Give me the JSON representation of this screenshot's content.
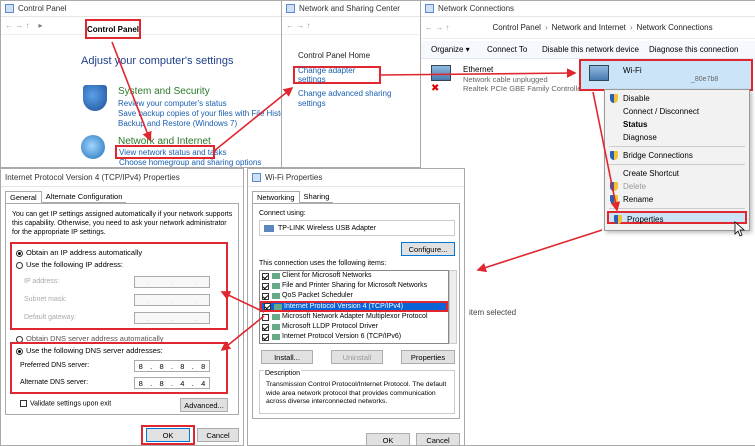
{
  "control_panel": {
    "title": "Control Panel",
    "breadcrumb": "Control Panel",
    "heading": "Adjust your computer's settings",
    "sections": [
      {
        "title": "System and Security",
        "links": [
          "Review your computer's status",
          "Save backup copies of your files with File History",
          "Backup and Restore (Windows 7)"
        ]
      },
      {
        "title": "Network and Internet",
        "links": [
          "View network status and tasks",
          "Choose homegroup and sharing options"
        ]
      }
    ]
  },
  "sharing_center": {
    "title": "Network and Sharing Center",
    "links": [
      "Control Panel Home",
      "Change adapter settings",
      "Change advanced sharing settings"
    ]
  },
  "net_connections": {
    "title": "Network Connections",
    "breadcrumb": [
      "Control Panel",
      "Network and Internet",
      "Network Connections"
    ],
    "toolbar": [
      "Organize ▾",
      "Connect To",
      "Disable this network device",
      "Diagnose this connection"
    ],
    "adapters": [
      {
        "name": "Ethernet",
        "status": "Network cable unplugged",
        "device": "Realtek PCIe GBE Family Controller"
      },
      {
        "name": "Wi-Fi",
        "status": "_80e7b8",
        "device": "TP-LINK Wireless USB Adapter"
      }
    ],
    "status_text": "item selected",
    "context_menu": [
      "Disable",
      "Connect / Disconnect",
      "Status",
      "Diagnose",
      "Bridge Connections",
      "Create Shortcut",
      "Delete",
      "Rename",
      "Properties"
    ]
  },
  "ipv4": {
    "title": "Internet Protocol Version 4 (TCP/IPv4) Properties",
    "tabs": [
      "General",
      "Alternate Configuration"
    ],
    "description": "You can get IP settings assigned automatically if your network supports this capability. Otherwise, you need to ask your network administrator for the appropriate IP settings.",
    "ip_auto": "Obtain an IP address automatically",
    "ip_manual": "Use the following IP address:",
    "ip_fields": [
      "IP address:",
      "Subnet mask:",
      "Default gateway:"
    ],
    "dns_auto": "Obtain DNS server address automatically",
    "dns_manual": "Use the following DNS server addresses:",
    "dns_pref_label": "Preferred DNS server:",
    "dns_pref": [
      "8",
      "8",
      "8",
      "8"
    ],
    "dns_alt_label": "Alternate DNS server:",
    "dns_alt": [
      "8",
      "8",
      "4",
      "4"
    ],
    "validate": "Validate settings upon exit",
    "advanced": "Advanced...",
    "ok": "OK",
    "cancel": "Cancel"
  },
  "wifi_props": {
    "title": "Wi-Fi Properties",
    "tabs": [
      "Networking",
      "Sharing"
    ],
    "connect_using": "Connect using:",
    "adapter": "TP-LINK Wireless USB Adapter",
    "configure": "Configure...",
    "items_label": "This connection uses the following items:",
    "items": [
      {
        "label": "Client for Microsoft Networks",
        "checked": true
      },
      {
        "label": "File and Printer Sharing for Microsoft Networks",
        "checked": true
      },
      {
        "label": "QoS Packet Scheduler",
        "checked": true
      },
      {
        "label": "Internet Protocol Version 4 (TCP/IPv4)",
        "checked": true
      },
      {
        "label": "Microsoft Network Adapter Multiplexor Protocol",
        "checked": false
      },
      {
        "label": "Microsoft LLDP Protocol Driver",
        "checked": true
      },
      {
        "label": "Internet Protocol Version 6 (TCP/IPv6)",
        "checked": true
      }
    ],
    "install": "Install...",
    "uninstall": "Uninstall",
    "properties": "Properties",
    "desc_label": "Description",
    "description": "Transmission Control Protocol/Internet Protocol. The default wide area network protocol that provides communication across diverse interconnected networks.",
    "ok": "OK",
    "cancel": "Cancel"
  },
  "colors": {
    "highlight": "#e0262f",
    "link": "#1b5fb0",
    "selection": "#0a64d8"
  }
}
